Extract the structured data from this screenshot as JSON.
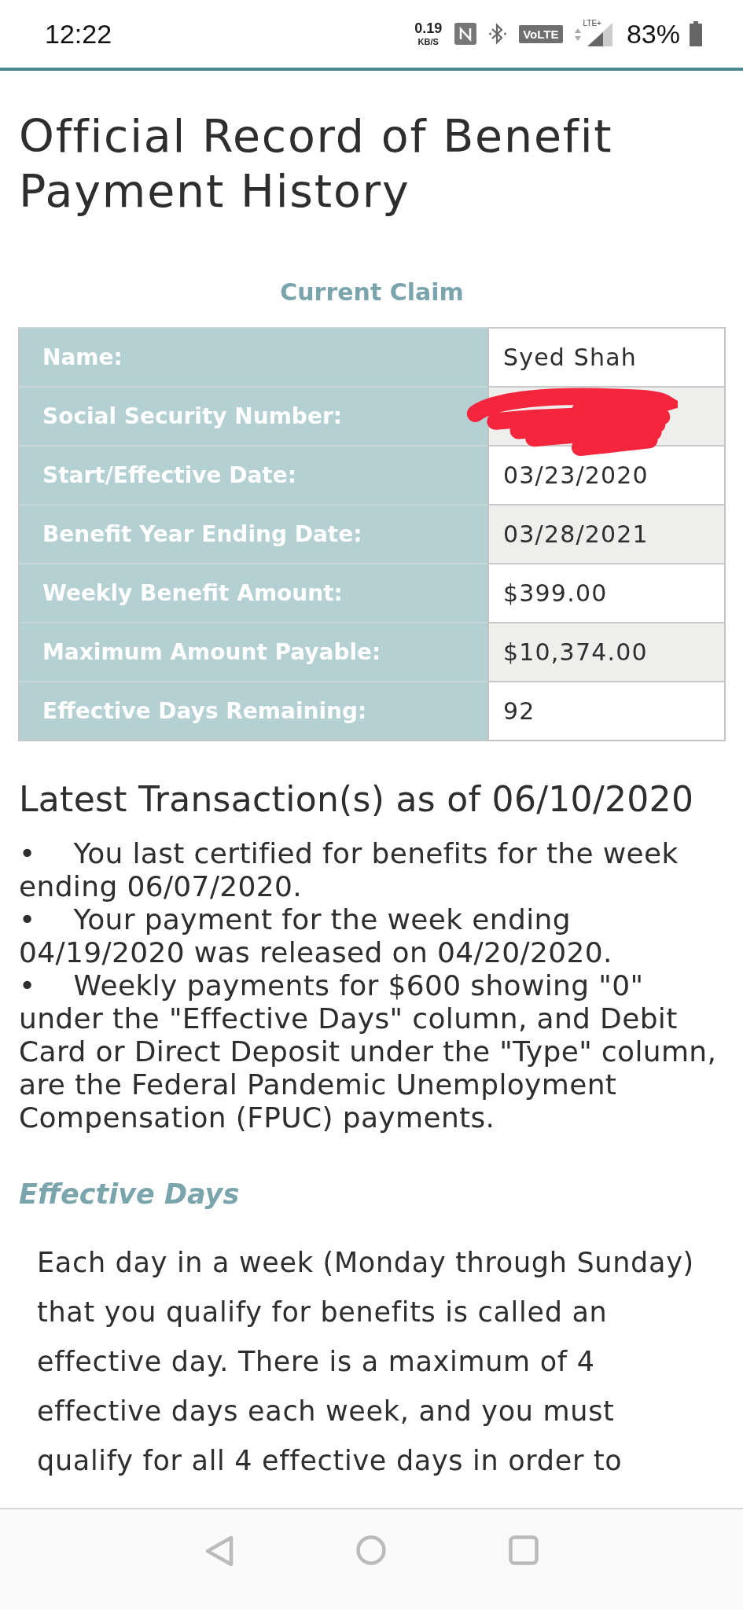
{
  "status_bar": {
    "time": "12:22",
    "data_speed": "0.19",
    "data_unit": "KB/S",
    "network_badge": "VoLTE",
    "network_type": "LTE+",
    "battery": "83%"
  },
  "page": {
    "title": "Official Record of Benefit Payment History"
  },
  "current_claim": {
    "heading": "Current Claim",
    "rows": [
      {
        "label": "Name:",
        "value": "Syed Shah",
        "redacted": false
      },
      {
        "label": "Social Security Number:",
        "redacted": true
      },
      {
        "label": "Start/Effective Date:",
        "value": "03/23/2020",
        "redacted": false
      },
      {
        "label": "Benefit Year Ending Date:",
        "value": "03/28/2021",
        "redacted": false
      },
      {
        "label": "Weekly Benefit Amount:",
        "value": "$399.00",
        "redacted": false
      },
      {
        "label": "Maximum Amount Payable:",
        "value": "$10,374.00",
        "redacted": false
      },
      {
        "label": "Effective Days Remaining:",
        "value": "92",
        "redacted": false
      }
    ]
  },
  "latest_transactions": {
    "heading": "Latest Transaction(s) as of 06/10/2020",
    "items": [
      {
        "bullet": "•",
        "text": "You last certified for benefits for the week ending 06/07/2020."
      },
      {
        "bullet": "•",
        "text": "Your payment for the week ending 04/19/2020 was released on 04/20/2020."
      },
      {
        "bullet": "•",
        "text": "Weekly payments for $600 showing \"0\" under the \"Effective Days\" column, and Debit Card or Direct Deposit under the \"Type\" column, are the Federal Pandemic Unemployment Compensation (FPUC) payments."
      }
    ]
  },
  "effective_days": {
    "heading": "Effective Days",
    "paragraph": "Each day in a week (Monday through Sunday) that you qualify for benefits is called an effective day. There is a maximum of 4 effective days each week, and you must qualify for all 4 effective days in order to"
  }
}
